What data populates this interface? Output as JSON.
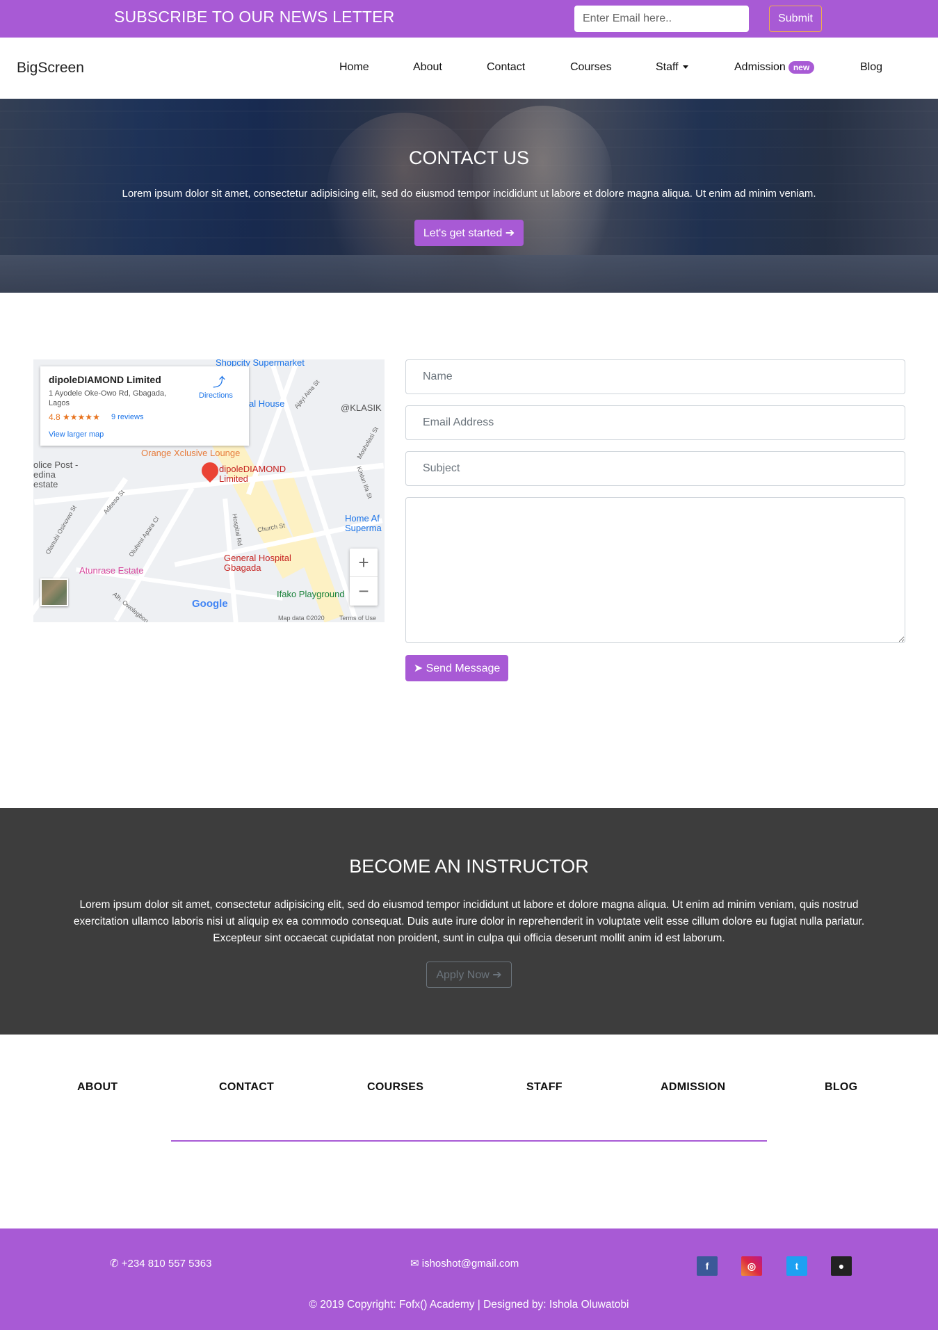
{
  "newsletter": {
    "title": "SUBSCRIBE TO OUR NEWS LETTER",
    "email_placeholder": "Enter Email here..",
    "submit_label": "Submit"
  },
  "navbar": {
    "brand": "BigScreen",
    "items": [
      {
        "label": "Home"
      },
      {
        "label": "About"
      },
      {
        "label": "Contact"
      },
      {
        "label": "Courses"
      },
      {
        "label": "Staff"
      },
      {
        "label": "Admission",
        "badge": "new"
      },
      {
        "label": "Blog"
      }
    ]
  },
  "hero": {
    "title": "CONTACT US",
    "text": "Lorem ipsum dolor sit amet, consectetur adipisicing elit, sed do eiusmod tempor incididunt ut labore et dolore magna aliqua. Ut enim ad minim veniam.",
    "cta_label": "Let's get started"
  },
  "map": {
    "place_name": "dipoleDIAMOND Limited",
    "address": "1 Ayodele Oke-Owo Rd, Gbagada, Lagos",
    "rating": "4.8",
    "stars": "★★★★★",
    "reviews": "9 reviews",
    "directions": "Directions",
    "larger_map": "View larger map",
    "marker_label": "dipoleDIAMOND Limited",
    "labels": {
      "shopcity": "Shopcity Supermarket",
      "house": "al House",
      "klasik": "@KLASIK",
      "orange": "Orange Xclusive Lounge",
      "police": "olice Post - edina estate",
      "home": "Home Af Superma",
      "hospital": "General Hospital Gbagada",
      "atunrase": "Atunrase Estate",
      "ifako": "Ifako Playground",
      "google": "Google",
      "mapdata": "Map data ©2020",
      "terms": "Terms of Use",
      "church": "Church St",
      "hospital_rd": "Hospital Rd",
      "ajayi": "Ajayi Aina St",
      "adeeso": "Adeeso St",
      "olufemi": "Olufemi Apara Cl",
      "olanubi": "Olanubi Osinowo St",
      "alh": "Alh. Owolegbon",
      "mosholasi": "Mosholasi St",
      "kinlun": "Kinlun Ifa St",
      "zoom_in": "+",
      "zoom_out": "−"
    }
  },
  "form": {
    "name_placeholder": "Name",
    "email_placeholder": "Email Address",
    "subject_placeholder": "Subject",
    "message_value": "",
    "send_label": "Send Message"
  },
  "instructor": {
    "title": "BECOME AN INSTRUCTOR",
    "text": "Lorem ipsum dolor sit amet, consectetur adipisicing elit, sed do eiusmod tempor incididunt ut labore et dolore magna aliqua. Ut enim ad minim veniam, quis nostrud exercitation ullamco laboris nisi ut aliquip ex ea commodo consequat. Duis aute irure dolor in reprehenderit in voluptate velit esse cillum dolore eu fugiat nulla pariatur. Excepteur sint occaecat cupidatat non proident, sunt in culpa qui officia deserunt mollit anim id est laborum.",
    "apply_label": "Apply Now"
  },
  "footer_links": [
    "ABOUT",
    "CONTACT",
    "COURSES",
    "STAFF",
    "ADMISSION",
    "BLOG"
  ],
  "bottom": {
    "phone": "+234 810 557 5363",
    "email": "ishoshot@gmail.com",
    "copyright": "© 2019 Copyright: Fofx() Academy | Designed by: Ishola Oluwatobi",
    "social": [
      {
        "icon": "facebook-icon",
        "glyph": "f",
        "color": "#3b5998"
      },
      {
        "icon": "instagram-icon",
        "glyph": "◎",
        "color": "#d6249f"
      },
      {
        "icon": "twitter-icon",
        "glyph": "t",
        "color": "#1da1f2"
      },
      {
        "icon": "github-icon",
        "glyph": "●",
        "color": "#222222"
      }
    ]
  },
  "colors": {
    "accent": "#a85ad5",
    "dark_section": "#3d3d3d"
  }
}
